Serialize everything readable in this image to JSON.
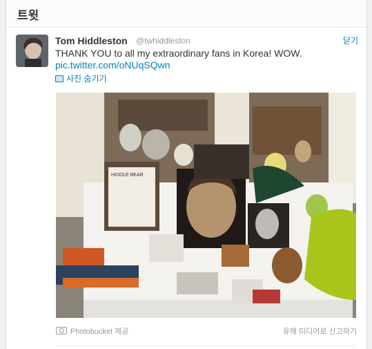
{
  "header": {
    "title": "트윗"
  },
  "tweet": {
    "name": "Tom Hiddleston",
    "handle": "@twhiddleston",
    "close_label": "닫기",
    "text": "THANK YOU to all my extraordinary fans in Korea! WOW.",
    "link": "pic.twitter.com/oNUqSQwn",
    "hide_photo_label": "사진 숨기기"
  },
  "photo_text": {
    "poster_title": "HIDDLE BEAR"
  },
  "footer": {
    "provider": "Photobucket 제공",
    "report": "유해 미디어로 신고하기"
  },
  "icons": [
    "photo-icon",
    "camera-icon"
  ]
}
